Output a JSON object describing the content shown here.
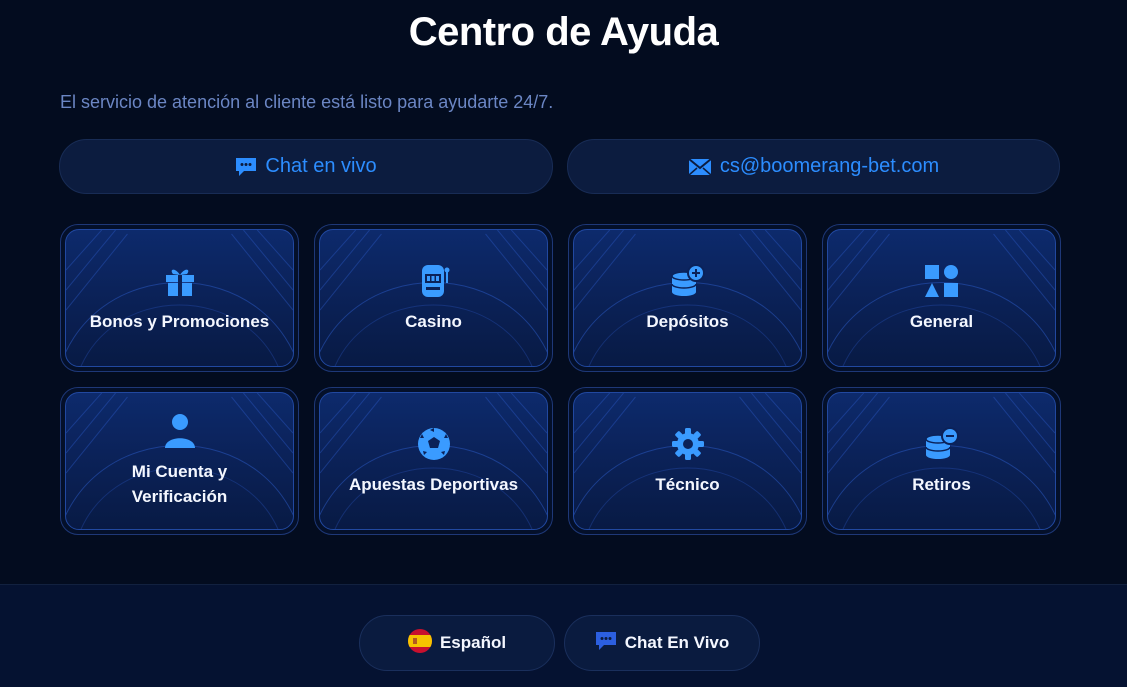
{
  "page": {
    "title": "Centro de Ayuda",
    "subtitle": "El servicio de atención al cliente está listo para ayudarte 24/7."
  },
  "contacts": {
    "chat_label": "Chat en vivo",
    "email_label": "cs@boomerang-bet.com"
  },
  "categories": [
    {
      "label": "Bonos y Promociones",
      "icon": "gift-icon"
    },
    {
      "label": "Casino",
      "icon": "slot-machine-icon"
    },
    {
      "label": "Depósitos",
      "icon": "coins-plus-icon"
    },
    {
      "label": "General",
      "icon": "shapes-icon"
    },
    {
      "label": "Mi Cuenta y\nVerificación",
      "icon": "user-icon"
    },
    {
      "label": "Apuestas Deportivas",
      "icon": "soccer-ball-icon"
    },
    {
      "label": "Técnico",
      "icon": "gear-icon"
    },
    {
      "label": "Retiros",
      "icon": "coins-minus-icon"
    }
  ],
  "footer": {
    "language_label": "Español",
    "language_flag": "spain-flag-icon",
    "live_chat_label": "Chat En Vivo"
  },
  "colors": {
    "background": "#030c1f",
    "accent": "#2c8dff",
    "card_top": "#0d2a6c",
    "subtitle": "#6b86c4"
  }
}
